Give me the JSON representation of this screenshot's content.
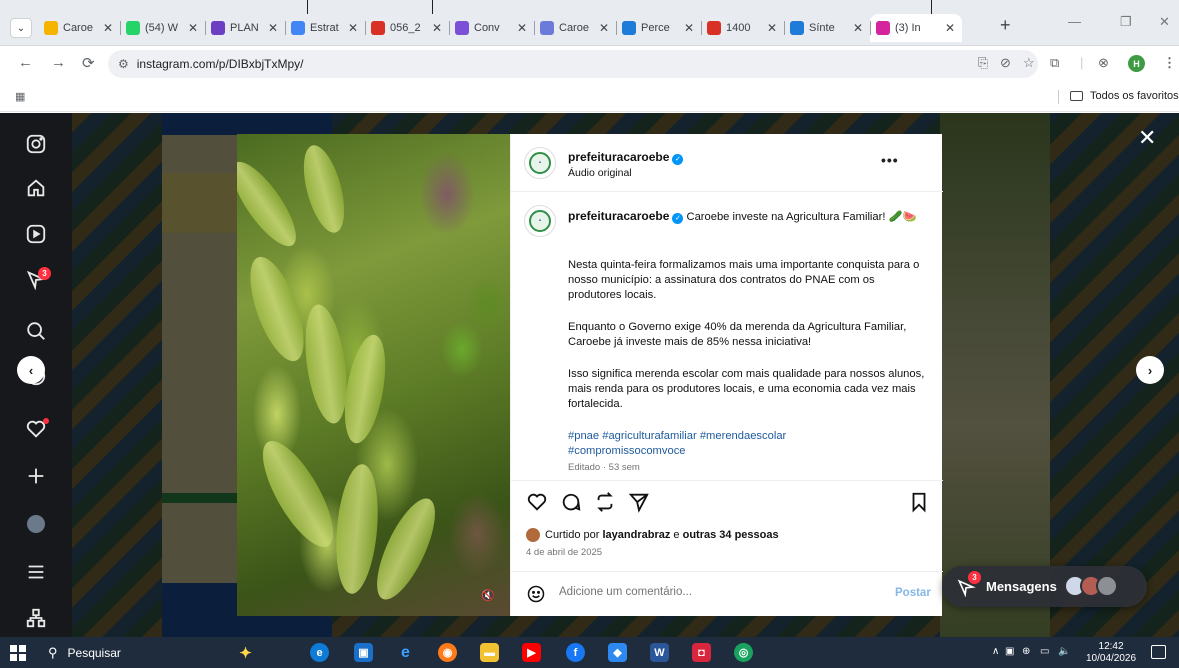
{
  "browser": {
    "tabs": [
      {
        "title": "Caroe",
        "favicon_color": "#f4b400",
        "active": false
      },
      {
        "title": "(54) W",
        "favicon_color": "#25d366",
        "active": false
      },
      {
        "title": "PLAN",
        "favicon_color": "#6a3fc2",
        "active": false
      },
      {
        "title": "Estrat",
        "favicon_color": "#4285f4",
        "active": false
      },
      {
        "title": "056_2",
        "favicon_color": "#d93025",
        "active": false
      },
      {
        "title": "Conv",
        "favicon_color": "#7b4fd6",
        "active": false
      },
      {
        "title": "Caroe",
        "favicon_color": "#6c7bd9",
        "active": false
      },
      {
        "title": "Perce",
        "favicon_color": "#1f7bd8",
        "active": false
      },
      {
        "title": "1400",
        "favicon_color": "#d93025",
        "active": false
      },
      {
        "title": "Sínte",
        "favicon_color": "#1f7bd8",
        "active": false
      },
      {
        "title": "(3) In",
        "favicon_color": "#d6249f",
        "active": true
      }
    ],
    "tab_close_glyph": "✕",
    "new_tab_glyph": "+",
    "url": "instagram.com/p/DIBxbjTxMpy/",
    "profile_initial": "H",
    "bookmarks_folder": "Todos os favoritos"
  },
  "instagram": {
    "post": {
      "username": "prefeituracaroebe",
      "audio": "Áudio original",
      "caption_lead": "Caroebe investe na Agricultura Familiar! 🥒🍉",
      "paragraphs": [
        "Nesta quinta-feira formalizamos mais uma importante conquista para o nosso município: a assinatura dos contratos do PNAE com os produtores locais.",
        "Enquanto o Governo exige 40% da merenda da Agricultura Familiar, Caroebe já investe mais de 85% nessa iniciativa!",
        "Isso significa merenda escolar com mais qualidade para nossos alunos, mais renda para os produtores locais, e uma economia cada vez mais fortalecida."
      ],
      "hashtags": "#pnae #agriculturafamiliar #merendaescolar #compromissocomvoce",
      "edited": "Editado · 53 sem",
      "likes_prefix": "Curtido por ",
      "liked_by": "layandrabraz",
      "likes_joiner": " e ",
      "likes_others": "outras 34 pessoas",
      "date": "4 de abril de 2025",
      "comment_placeholder": "Adicione um comentário...",
      "post_button": "Postar"
    },
    "notification_count": "3",
    "messages_label": "Mensagens",
    "messages_count": "3"
  },
  "taskbar": {
    "search_label": "Pesquisar",
    "time": "12:42",
    "date": "10/04/2026"
  }
}
